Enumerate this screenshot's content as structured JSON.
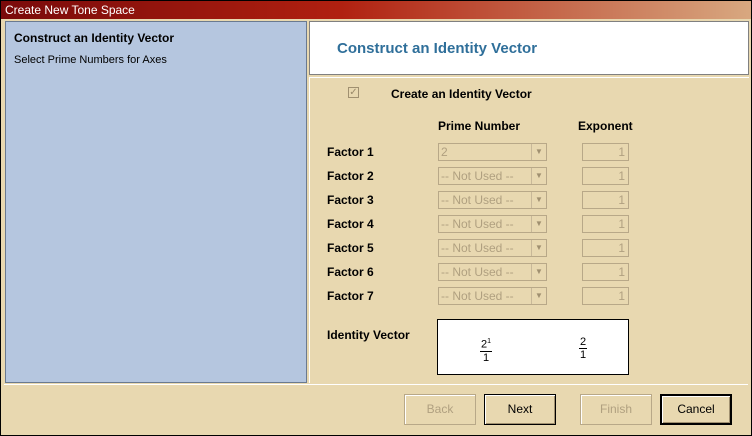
{
  "window": {
    "title": "Create New Tone Space"
  },
  "sidebar": {
    "step_title": "Construct an Identity Vector",
    "step_subtitle": "Select Prime Numbers for Axes"
  },
  "header": {
    "title": "Construct an Identity Vector"
  },
  "form": {
    "checkbox_label": "Create an Identity Vector",
    "checkbox_checked": true,
    "col_prime": "Prime Number",
    "col_exponent": "Exponent",
    "factors": [
      {
        "label": "Factor 1",
        "prime": "2",
        "exponent": "1"
      },
      {
        "label": "Factor 2",
        "prime": "-- Not Used --",
        "exponent": "1"
      },
      {
        "label": "Factor 3",
        "prime": "-- Not Used --",
        "exponent": "1"
      },
      {
        "label": "Factor 4",
        "prime": "-- Not Used --",
        "exponent": "1"
      },
      {
        "label": "Factor 5",
        "prime": "-- Not Used --",
        "exponent": "1"
      },
      {
        "label": "Factor 6",
        "prime": "-- Not Used --",
        "exponent": "1"
      },
      {
        "label": "Factor 7",
        "prime": "-- Not Used --",
        "exponent": "1"
      }
    ],
    "identity_label": "Identity Vector",
    "identity": {
      "left_base": "2",
      "left_exp": "1",
      "left_den": "1",
      "right_num": "2",
      "right_den": "1"
    }
  },
  "buttons": {
    "back": "Back",
    "next": "Next",
    "finish": "Finish",
    "cancel": "Cancel"
  },
  "colors": {
    "accent_title": "#2f6f9a",
    "panel_blue": "#b5c6df",
    "dialog_bg": "#e8d8b0"
  }
}
